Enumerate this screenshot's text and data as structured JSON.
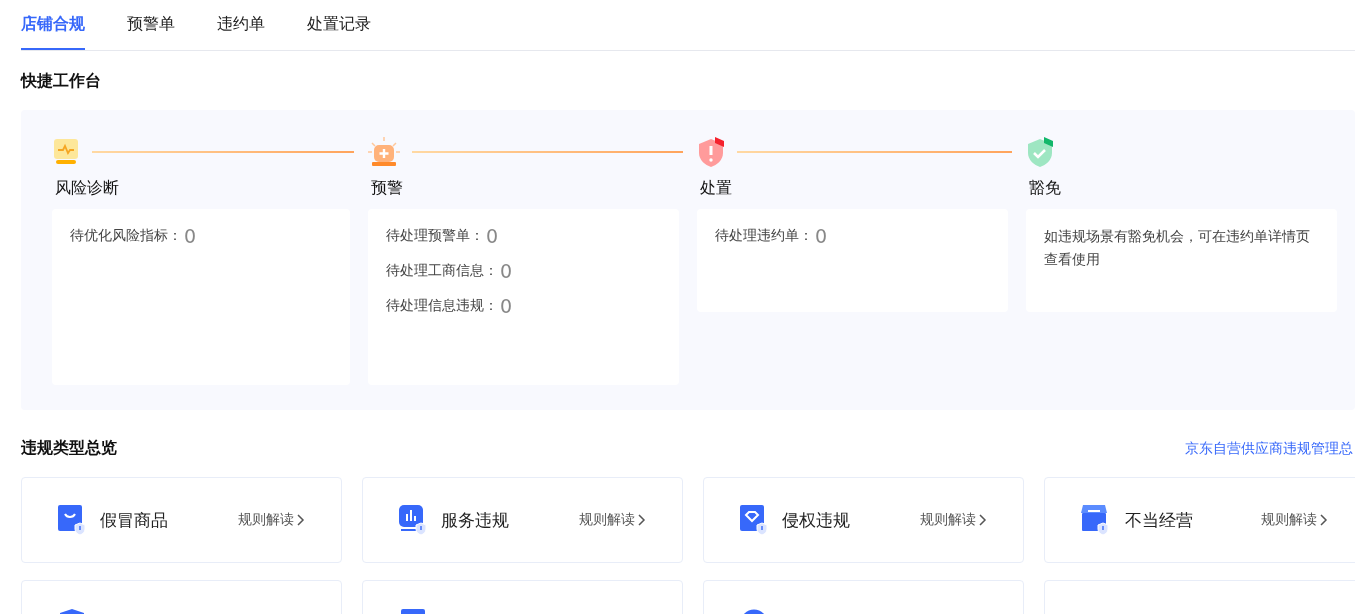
{
  "tabs": [
    {
      "label": "店铺合规",
      "selected": true
    },
    {
      "label": "预警单",
      "selected": false
    },
    {
      "label": "违约单",
      "selected": false
    },
    {
      "label": "处置记录",
      "selected": false
    }
  ],
  "workbench": {
    "title": "快捷工作台",
    "steps": [
      {
        "kind": "diagnose",
        "title": "风险诊断",
        "items": [
          {
            "label": "待优化风险指标：",
            "value": "0"
          }
        ]
      },
      {
        "kind": "warning",
        "title": "预警",
        "items": [
          {
            "label": "待处理预警单：",
            "value": "0"
          },
          {
            "label": "待处理工商信息：",
            "value": "0"
          },
          {
            "label": "待处理信息违规：",
            "value": "0"
          }
        ]
      },
      {
        "kind": "handle",
        "title": "处置",
        "items": [
          {
            "label": "待处理违约单：",
            "value": "0"
          }
        ]
      },
      {
        "kind": "exempt",
        "title": "豁免",
        "note": "如违规场景有豁免机会，可在违约单详情页查看使用"
      }
    ]
  },
  "overview": {
    "title": "违规类型总览",
    "link": "京东自营供应商违规管理总",
    "cards": [
      {
        "kind": "bag",
        "name": "假冒商品",
        "action": "规则解读"
      },
      {
        "kind": "chart",
        "name": "服务违规",
        "action": "规则解读"
      },
      {
        "kind": "gem",
        "name": "侵权违规",
        "action": "规则解读"
      },
      {
        "kind": "store",
        "name": "不当经营",
        "action": "规则解读"
      },
      {
        "kind": "shield"
      },
      {
        "kind": "doc"
      },
      {
        "kind": "ring"
      },
      {
        "kind": "blank"
      }
    ]
  }
}
